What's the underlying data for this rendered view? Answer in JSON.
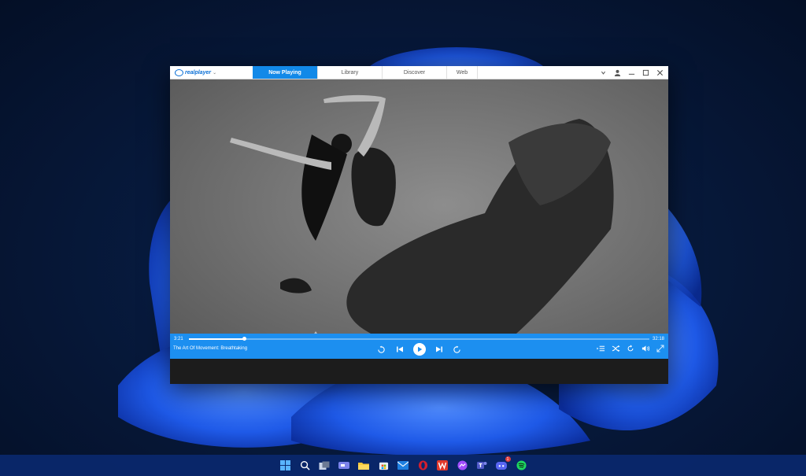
{
  "app": {
    "logo_text": "realplayer",
    "logo_chevron": "⌄"
  },
  "tabs": [
    {
      "label": "Now Playing",
      "active": true
    },
    {
      "label": "Library",
      "active": false
    },
    {
      "label": "Discover",
      "active": false
    },
    {
      "label": "Web",
      "active": false
    }
  ],
  "window_controls": {
    "account_dropdown_icon": "chevron-down-icon",
    "account_icon": "user-icon",
    "minimize_icon": "minimize-icon",
    "maximize_icon": "maximize-icon",
    "close_icon": "close-icon"
  },
  "player": {
    "elapsed": "3:21",
    "duration": "32:18",
    "progress": 0.12,
    "track_title": "The Art Of Movement: Breathtaking"
  },
  "transport_icons": [
    "replay-10-icon",
    "previous-track-icon",
    "play-icon",
    "next-track-icon",
    "forward-10-icon"
  ],
  "right_icons": [
    "playlist-icon",
    "shuffle-icon",
    "repeat-icon",
    "volume-icon",
    "fullscreen-icon"
  ],
  "taskbar": {
    "icons": [
      "windows-start-icon",
      "search-icon",
      "task-view-icon",
      "teams-chat-icon",
      "file-explorer-icon",
      "microsoft-store-icon",
      "mail-icon",
      "opera-icon",
      "wps-office-icon",
      "messenger-icon",
      "teams-icon",
      "discord-icon",
      "spotify-icon"
    ],
    "discord_badge": "1"
  },
  "colors": {
    "accent": "#1289e8",
    "controls_bar": "#1c8ff0",
    "taskbar": "#0a286e"
  }
}
